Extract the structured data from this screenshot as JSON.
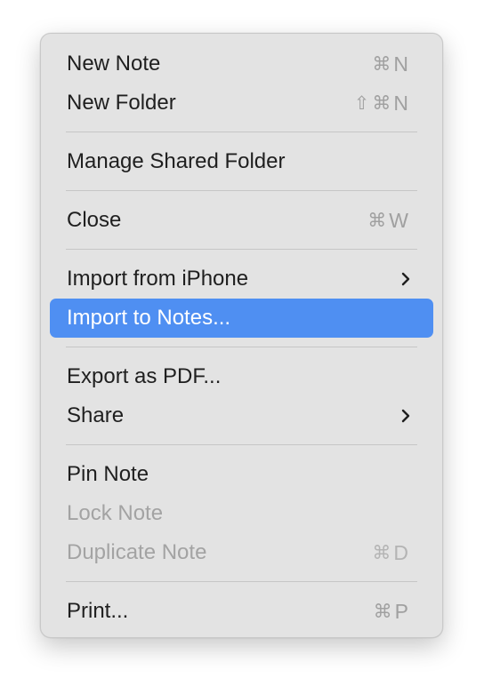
{
  "menu": {
    "new_note": {
      "label": "New Note",
      "shortcut_key": "N"
    },
    "new_folder": {
      "label": "New Folder",
      "shortcut_key": "N"
    },
    "manage_shared_folder": {
      "label": "Manage Shared Folder"
    },
    "close": {
      "label": "Close",
      "shortcut_key": "W"
    },
    "import_from_iphone": {
      "label": "Import from iPhone"
    },
    "import_to_notes": {
      "label": "Import to Notes..."
    },
    "export_as_pdf": {
      "label": "Export as PDF..."
    },
    "share": {
      "label": "Share"
    },
    "pin_note": {
      "label": "Pin Note"
    },
    "lock_note": {
      "label": "Lock Note"
    },
    "duplicate_note": {
      "label": "Duplicate Note",
      "shortcut_key": "D"
    },
    "print": {
      "label": "Print...",
      "shortcut_key": "P"
    }
  },
  "symbols": {
    "command": "⌘",
    "shift": "⇧"
  },
  "colors": {
    "menu_background": "#e3e3e3",
    "highlight": "#4f8ff2",
    "text": "#1f1f1f",
    "disabled_text": "#a3a3a3",
    "shortcut_text": "#a0a0a0",
    "separator": "#c6c6c6"
  },
  "icons": {
    "command": "command-icon",
    "shift": "shift-icon",
    "submenu": "chevron-right-icon"
  }
}
